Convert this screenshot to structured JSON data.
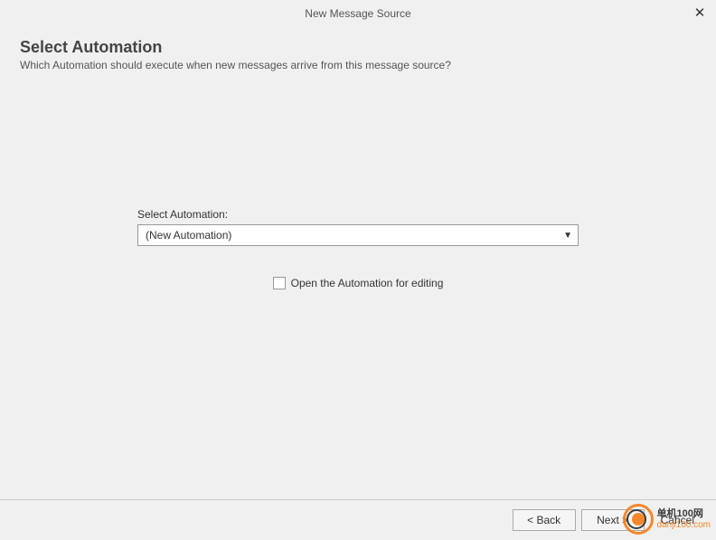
{
  "titlebar": {
    "title": "New Message Source",
    "close_icon": "✕"
  },
  "header": {
    "heading": "Select Automation",
    "subheading": "Which Automation should execute when new messages arrive from this message source?"
  },
  "form": {
    "select_label": "Select Automation:",
    "select_value": "(New Automation)",
    "checkbox_label": "Open the Automation for editing",
    "checkbox_checked": false
  },
  "footer": {
    "back": "< Back",
    "next": "Next >",
    "cancel": "Cancel"
  },
  "watermark": {
    "line1": "单机100网",
    "line2": "danji100.com"
  }
}
